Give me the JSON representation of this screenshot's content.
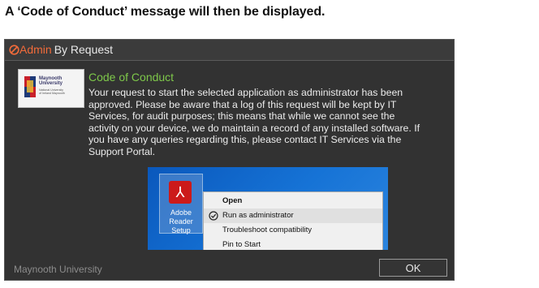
{
  "heading": "A ‘Code of Conduct’ message will then be displayed.",
  "dialog": {
    "brand_admin": "Admin",
    "brand_rest": "By Request",
    "logo": {
      "name": "Maynooth\nUniversity",
      "sub": "National University\nof Ireland Maynooth"
    },
    "title": "Code of Conduct",
    "message": "Your request to start the selected application as administrator has been approved. Please be aware that a log of this request will be kept by IT Services, for audit purposes; this means that while we cannot see the activity on your device, we do maintain a record of any installed software. If you have any queries regarding this, please contact IT Services via the Support Portal.",
    "footer": "Maynooth University",
    "ok_label": "OK"
  },
  "screenshot": {
    "app_label": "Adobe Reader Setup",
    "menu": [
      {
        "label": "Open",
        "bold": true
      },
      {
        "label": "Run as administrator",
        "icon": "shield-check-icon"
      },
      {
        "label": "Troubleshoot compatibility"
      },
      {
        "label": "Pin to Start"
      }
    ]
  },
  "colors": {
    "accent_orange": "#f26b3a",
    "title_green": "#7ec84a",
    "dialog_bg": "#323232",
    "desktop_blue": "#1066c8"
  }
}
